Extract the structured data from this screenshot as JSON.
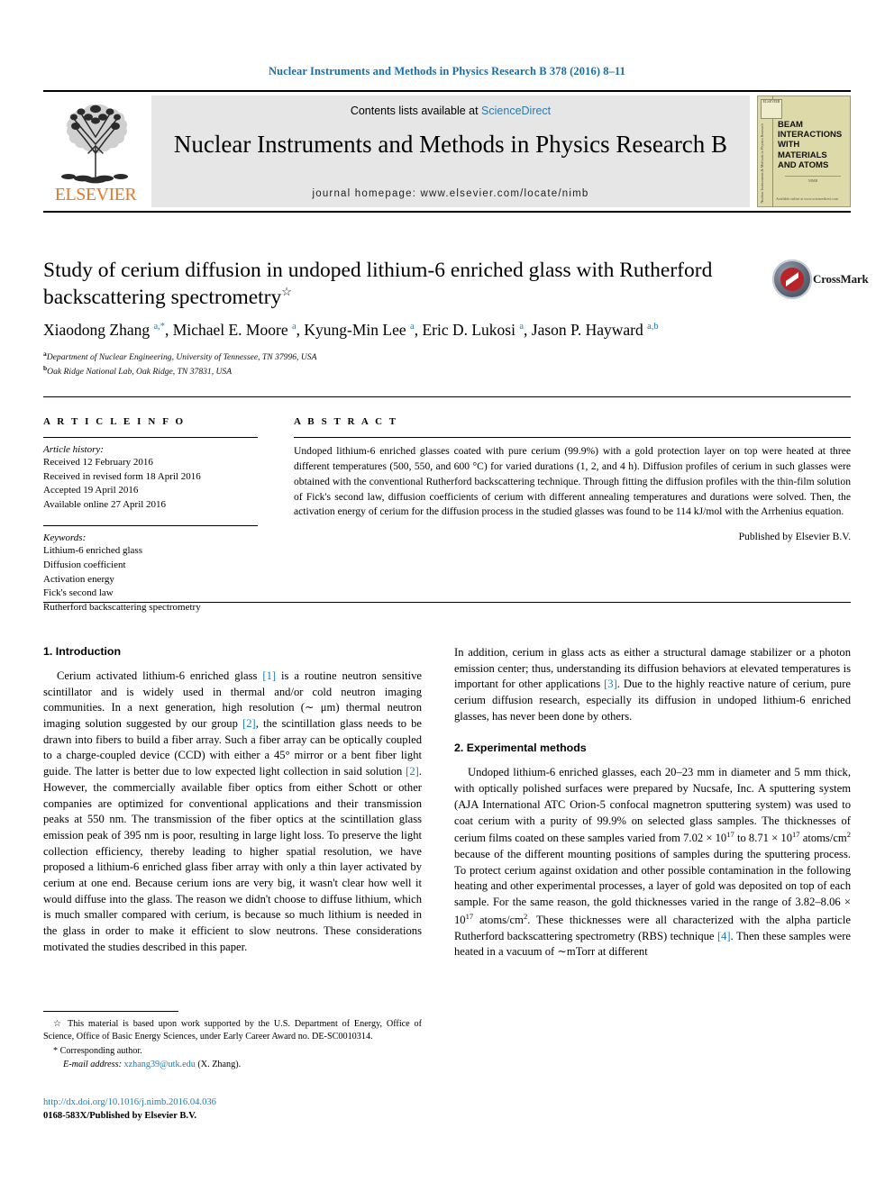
{
  "running_head": "Nuclear Instruments and Methods in Physics Research B 378 (2016) 8–11",
  "masthead": {
    "contents_prefix": "Contents lists available at ",
    "sciencedirect": "ScienceDirect",
    "journal_title": "Nuclear Instruments and Methods in Physics Research B",
    "homepage": "journal homepage: www.elsevier.com/locate/nimb",
    "publisher_wordmark": "ELSEVIER",
    "cover": {
      "title": "BEAM INTERACTIONS WITH MATERIALS AND ATOMS",
      "spine_text": "Nuclear Instruments & Methods in Physics Research",
      "badge": "ELSEVIER",
      "foot_center": "NIMB",
      "foot_bottom": "Available online at www.sciencedirect.com"
    }
  },
  "article": {
    "title": "Study of cerium diffusion in undoped lithium-6 enriched glass with Rutherford backscattering spectrometry",
    "title_footnote_marker": "☆",
    "crossmark_label": "CrossMark",
    "authors_html": "Xiaodong Zhang <sup>a,*</sup>, Michael E. Moore <sup>a</sup>, Kyung-Min Lee <sup>a</sup>, Eric D. Lukosi <sup>a</sup>, Jason P. Hayward <sup>a,b</sup>",
    "affiliations": [
      {
        "marker": "a",
        "text": "Department of Nuclear Engineering, University of Tennessee, TN 37996, USA"
      },
      {
        "marker": "b",
        "text": "Oak Ridge National Lab, Oak Ridge, TN 37831, USA"
      }
    ]
  },
  "article_info": {
    "label": "A R T I C L E    I N F O",
    "history_label": "Article history:",
    "history": [
      "Received 12 February 2016",
      "Received in revised form 18 April 2016",
      "Accepted 19 April 2016",
      "Available online 27 April 2016"
    ],
    "keywords_label": "Keywords:",
    "keywords": [
      "Lithium-6 enriched glass",
      "Diffusion coefficient",
      "Activation energy",
      "Fick's second law",
      "Rutherford backscattering spectrometry"
    ]
  },
  "abstract": {
    "label": "A B S T R A C T",
    "text": "Undoped lithium-6 enriched glasses coated with pure cerium (99.9%) with a gold protection layer on top were heated at three different temperatures (500, 550, and 600 °C) for varied durations (1, 2, and 4 h). Diffusion profiles of cerium in such glasses were obtained with the conventional Rutherford backscattering technique. Through fitting the diffusion profiles with the thin-film solution of Fick's second law, diffusion coefficients of cerium with different annealing temperatures and durations were solved. Then, the activation energy of cerium for the diffusion process in the studied glasses was found to be 114 kJ/mol with the Arrhenius equation.",
    "publisher_note": "Published by Elsevier B.V."
  },
  "body": {
    "section1_heading": "1. Introduction",
    "section2_heading": "2. Experimental methods",
    "p1_part1": "Cerium activated lithium-6 enriched glass ",
    "p1_ref1": "[1]",
    "p1_part2": " is a routine neutron sensitive scintillator and is widely used in thermal and/or cold neutron imaging communities. In a next generation, high resolution (∼ μm) thermal neutron imaging solution suggested by our group ",
    "p1_ref2": "[2]",
    "p1_part3": ", the scintillation glass needs to be drawn into fibers to build a fiber array. Such a fiber array can be optically coupled to a charge-coupled device (CCD) with either a 45° mirror or a bent fiber light guide. The latter is better due to low expected light collection in said solution ",
    "p1_ref3": "[2]",
    "p1_part4": ". However, the commercially available fiber optics from either Schott or other companies are optimized for conventional applications and their transmission peaks at 550 nm. The transmission of the fiber optics at the scintillation glass emission peak of 395 nm is poor, resulting in large light loss. To preserve the light collection efficiency, thereby leading to higher spatial resolution, we have proposed a lithium-6 enriched glass fiber array with only a thin layer activated by cerium at one end. Because cerium ions are very big, it wasn't clear how well it would diffuse into the glass. The reason we didn't choose to diffuse lithium, which is much smaller compared with cerium, is because so much lithium is needed in the glass in order to make it efficient to slow neutrons. These considerations motivated the studies described in this paper.",
    "p2_part1": "In addition, cerium in glass acts as either a structural damage stabilizer or a photon emission center; thus, understanding its diffusion behaviors at elevated temperatures is important for other applications ",
    "p2_ref1": "[3]",
    "p2_part2": ". Due to the highly reactive nature of cerium, pure cerium diffusion research, especially its diffusion in undoped lithium-6 enriched glasses, has never been done by others.",
    "p3_part1": "Undoped lithium-6 enriched glasses, each 20–23 mm in diameter and 5 mm thick, with optically polished surfaces were prepared by Nucsafe, Inc. A sputtering system (AJA International ATC Orion-5 confocal magnetron sputtering system) was used to coat cerium with a purity of 99.9% on selected glass samples. The thicknesses of cerium films coated on these samples varied from 7.02 × 10",
    "p3_sup1": "17",
    "p3_part2": " to 8.71 × 10",
    "p3_sup2": "17",
    "p3_part3": " atoms/cm",
    "p3_sup3": "2",
    "p3_part4": " because of the different mounting positions of samples during the sputtering process. To protect cerium against oxidation and other possible contamination in the following heating and other experimental processes, a layer of gold was deposited on top of each sample. For the same reason, the gold thicknesses varied in the range of 3.82–8.06 × 10",
    "p3_sup4": "17",
    "p3_part5": " atoms/cm",
    "p3_sup5": "2",
    "p3_part6": ". These thicknesses were all characterized with the alpha particle Rutherford backscattering spectrometry (RBS) technique ",
    "p3_ref1": "[4]",
    "p3_part7": ". Then these samples were heated in a vacuum of ∼mTorr at different"
  },
  "footnotes": {
    "funding_marker": "☆",
    "funding": "This material is based upon work supported by the U.S. Department of Energy, Office of Science, Office of Basic Energy Sciences, under Early Career Award no. DE-SC0010314.",
    "corresponding_marker": "*",
    "corresponding": "Corresponding author.",
    "email_label": "E-mail address:",
    "email": "xzhang39@utk.edu",
    "email_suffix": "(X. Zhang)."
  },
  "doi": {
    "url": "http://dx.doi.org/10.1016/j.nimb.2016.04.036",
    "issn_line": "0168-583X/Published by Elsevier B.V."
  },
  "colors": {
    "link_blue": "#1a7db6",
    "header_blue": "#1a6ea8",
    "elsevier_orange": "#e87722",
    "band_gray": "#e6e6e6",
    "crossmark_red": "#b8242a"
  }
}
